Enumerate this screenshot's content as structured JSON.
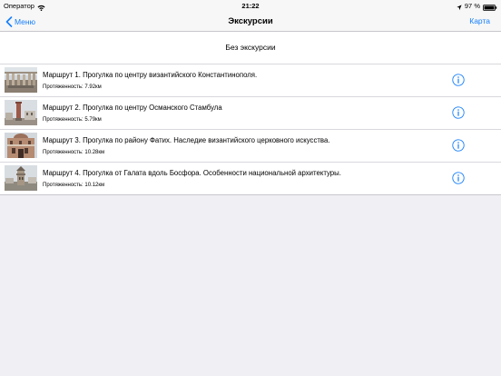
{
  "status_bar": {
    "carrier": "Оператор",
    "time": "21:22",
    "battery": "97 %"
  },
  "nav": {
    "back_label": "Меню",
    "title": "Экскурсии",
    "right_label": "Карта"
  },
  "no_excursion_label": "Без экскурсии",
  "routes": [
    {
      "title": "Маршрут 1. Прогулка по центру византийского Константинополя.",
      "length": "Протяженность: 7.92км",
      "thumb": "colonnade"
    },
    {
      "title": "Маршрут 2. Прогулка по центру Османского Стамбула",
      "length": "Протяженность: 5.79км",
      "thumb": "column"
    },
    {
      "title": "Маршрут 3. Прогулка по району Фатих. Наследие византийского церковного искусства.",
      "length": "Протяженность: 10.28км",
      "thumb": "church"
    },
    {
      "title": "Маршрут 4. Прогулка от Галата вдоль Босфора. Особенности национальной архитектуры.",
      "length": "Протяженность: 10.12км",
      "thumb": "tower"
    }
  ],
  "colors": {
    "accent": "#157efb",
    "background": "#efeff4",
    "bar": "#f7f7f7"
  }
}
